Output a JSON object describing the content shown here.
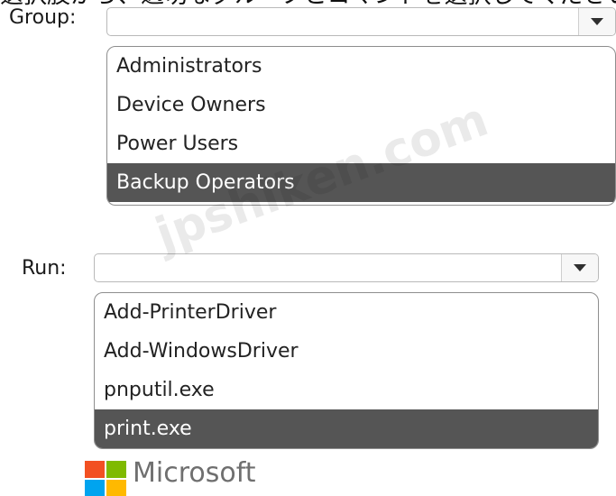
{
  "header_text": "選択肢から、適切なグループとコマンドを選択してください。権限",
  "group": {
    "label": "Group:",
    "value": "",
    "options": [
      "Administrators",
      "Device Owners",
      "Power Users",
      "Backup Operators"
    ],
    "selected_index": 3
  },
  "run": {
    "label": "Run:",
    "value": "",
    "options": [
      "Add-PrinterDriver",
      "Add-WindowsDriver",
      "pnputil.exe",
      "print.exe"
    ],
    "selected_index": 3
  },
  "footer": {
    "brand": "Microsoft",
    "logo_colors": [
      "#f25022",
      "#7fba00",
      "#00a4ef",
      "#ffb900"
    ]
  },
  "watermark": "jpshiken.com"
}
